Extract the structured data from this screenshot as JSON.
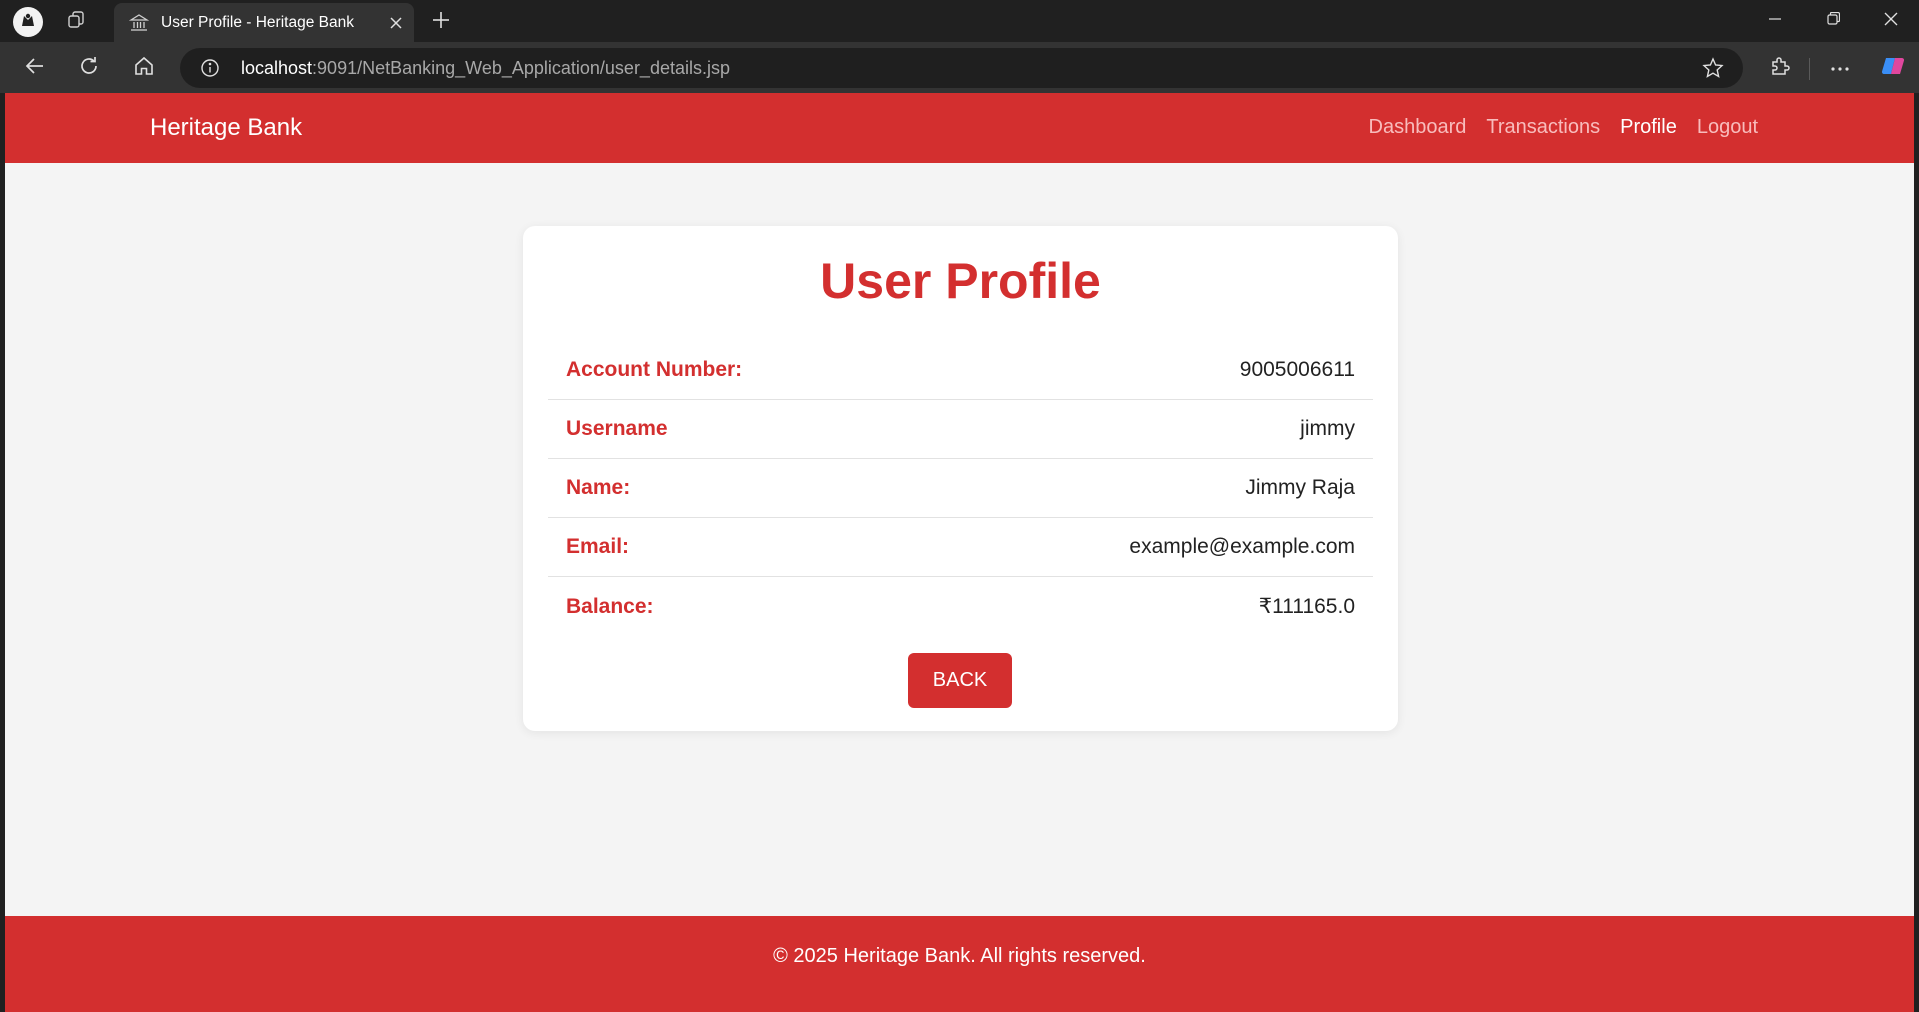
{
  "browser": {
    "tab_title": "User Profile - Heritage Bank",
    "url_host": "localhost",
    "url_path": ":9091/NetBanking_Web_Application/user_details.jsp",
    "icons": [
      "profile-icon",
      "workspaces-icon",
      "bank-icon",
      "close-icon",
      "plus-icon",
      "minimize-icon",
      "restore-icon",
      "back-arrow-icon",
      "refresh-icon",
      "home-icon",
      "info-icon",
      "star-icon",
      "extensions-icon",
      "more-icon",
      "copilot-icon"
    ]
  },
  "navbar": {
    "brand": "Heritage Bank",
    "links": [
      {
        "label": "Dashboard",
        "active": false
      },
      {
        "label": "Transactions",
        "active": false
      },
      {
        "label": "Profile",
        "active": true
      },
      {
        "label": "Logout",
        "active": false
      }
    ]
  },
  "profile": {
    "title": "User Profile",
    "rows": [
      {
        "label": "Account Number:",
        "value": "9005006611"
      },
      {
        "label": "Username",
        "value": "jimmy"
      },
      {
        "label": "Name:",
        "value": "Jimmy Raja"
      },
      {
        "label": "Email:",
        "value": "example@example.com"
      },
      {
        "label": "Balance:",
        "value": "₹111165.0"
      }
    ],
    "back_label": "BACK"
  },
  "footer": {
    "text": "© 2025 Heritage Bank. All rights reserved."
  },
  "colors": {
    "brand_red": "#d32f2f",
    "page_bg": "#f4f4f4",
    "chrome_dark": "#202020",
    "chrome_toolbar": "#333333"
  }
}
